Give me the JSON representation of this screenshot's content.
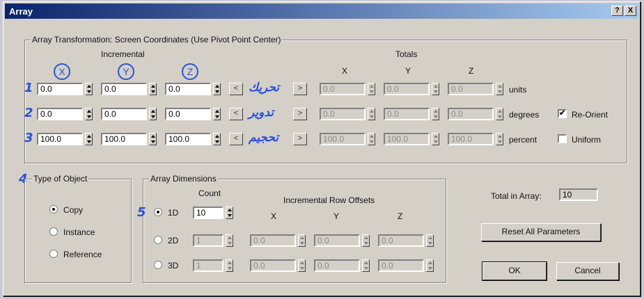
{
  "window": {
    "title": "Array",
    "help_btn": "?",
    "close_btn": "X"
  },
  "transform": {
    "group_title": "Array Transformation: Screen Coordinates (Use Pivot Point Center)",
    "incremental_label": "Incremental",
    "totals_label": "Totals",
    "axis_x": "X",
    "axis_y": "Y",
    "axis_z": "Z",
    "rows": [
      {
        "num": "1",
        "inc": [
          "0.0",
          "0.0",
          "0.0"
        ],
        "arabic": "تحريك",
        "totals": [
          "0.0",
          "0.0",
          "0.0"
        ],
        "unit": "units"
      },
      {
        "num": "2",
        "inc": [
          "0.0",
          "0.0",
          "0.0"
        ],
        "arabic": "تدوير",
        "totals": [
          "0.0",
          "0.0",
          "0.0"
        ],
        "unit": "degrees"
      },
      {
        "num": "3",
        "inc": [
          "100.0",
          "100.0",
          "100.0"
        ],
        "arabic": "تحجيم",
        "totals": [
          "100.0",
          "100.0",
          "100.0"
        ],
        "unit": "percent"
      }
    ],
    "left_arrow": "<",
    "right_arrow": ">",
    "reorient": {
      "label": "Re-Orient",
      "checked": true,
      "mark": "✔"
    },
    "uniform": {
      "label": "Uniform",
      "checked": false
    }
  },
  "type_of_object": {
    "num": "4",
    "title": "Type of Object",
    "options": [
      "Copy",
      "Instance",
      "Reference"
    ],
    "selected": "Copy"
  },
  "dimensions": {
    "num": "5",
    "title": "Array Dimensions",
    "count_label": "Count",
    "offsets_label": "Incremental Row Offsets",
    "axis_x": "X",
    "axis_y": "Y",
    "axis_z": "Z",
    "rows": [
      {
        "label": "1D",
        "count": "10",
        "selected": true
      },
      {
        "label": "2D",
        "count": "1",
        "offsets": [
          "0.0",
          "0.0",
          "0.0"
        ]
      },
      {
        "label": "3D",
        "count": "1",
        "offsets": [
          "0.0",
          "0.0",
          "0.0"
        ]
      }
    ]
  },
  "total_in_array": {
    "label": "Total in Array:",
    "value": "10"
  },
  "buttons": {
    "reset": "Reset All Parameters",
    "ok": "OK",
    "cancel": "Cancel"
  }
}
